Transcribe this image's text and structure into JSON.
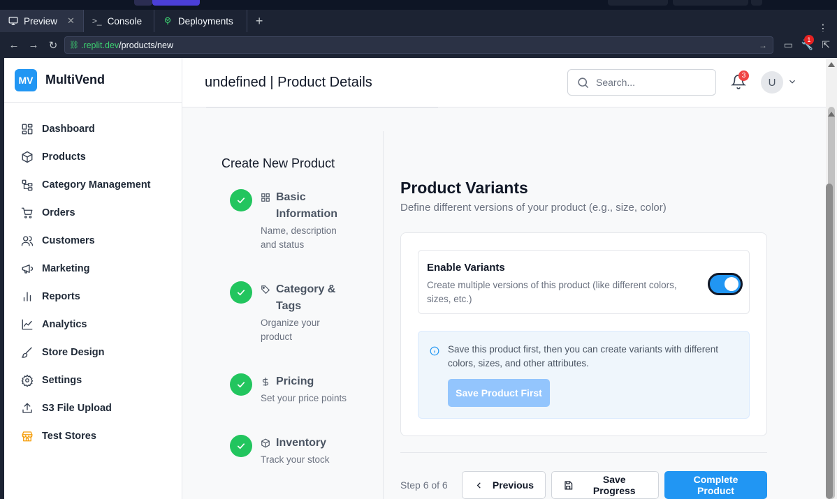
{
  "browser": {
    "tabs": [
      {
        "label": "Preview",
        "icon": "monitor-icon",
        "active": true
      },
      {
        "label": "Console",
        "icon": "terminal-icon",
        "active": false
      },
      {
        "label": "Deployments",
        "icon": "deploy-icon",
        "active": false
      }
    ],
    "url_domain": ".replit.dev",
    "url_path": "/products/new",
    "devtools_badge": "1"
  },
  "sidebar": {
    "logo": "MV",
    "brand": "MultiVend",
    "items": [
      {
        "label": "Dashboard",
        "icon": "dashboard-icon"
      },
      {
        "label": "Products",
        "icon": "box-icon"
      },
      {
        "label": "Category Management",
        "icon": "category-tree-icon"
      },
      {
        "label": "Orders",
        "icon": "cart-icon"
      },
      {
        "label": "Customers",
        "icon": "users-icon"
      },
      {
        "label": "Marketing",
        "icon": "megaphone-icon"
      },
      {
        "label": "Reports",
        "icon": "bar-chart-icon"
      },
      {
        "label": "Analytics",
        "icon": "line-chart-icon"
      },
      {
        "label": "Store Design",
        "icon": "brush-icon"
      },
      {
        "label": "Settings",
        "icon": "gear-icon"
      },
      {
        "label": "S3 File Upload",
        "icon": "upload-icon"
      },
      {
        "label": "Test Stores",
        "icon": "store-icon"
      }
    ]
  },
  "header": {
    "title": "undefined | Product Details",
    "search_placeholder": "Search...",
    "notification_count": "3",
    "avatar_initial": "U"
  },
  "wizard": {
    "title": "Create New Product",
    "steps": [
      {
        "title": "Basic Information",
        "desc": "Name, description and status",
        "icon": "grid-icon"
      },
      {
        "title": "Category & Tags",
        "desc": "Organize your product",
        "icon": "tag-icon"
      },
      {
        "title": "Pricing",
        "desc": "Set your price points",
        "icon": "dollar-icon"
      },
      {
        "title": "Inventory",
        "desc": "Track your stock",
        "icon": "package-icon"
      }
    ]
  },
  "variants": {
    "heading": "Product Variants",
    "subtitle": "Define different versions of your product (e.g., size, color)",
    "enable_title": "Enable Variants",
    "enable_desc": "Create multiple versions of this product (like different colors, sizes, etc.)",
    "enabled": true,
    "info_text": "Save this product first, then you can create variants with different colors, sizes, and other attributes.",
    "save_first_label": "Save Product First"
  },
  "footer": {
    "step_indicator": "Step 6 of 6",
    "previous_label": "Previous",
    "save_progress_label": "Save Progress",
    "complete_label": "Complete Product"
  },
  "colors": {
    "primary": "#2196f3",
    "success": "#22c55e",
    "danger": "#ef4444",
    "accent_orange": "#f59e0b"
  }
}
